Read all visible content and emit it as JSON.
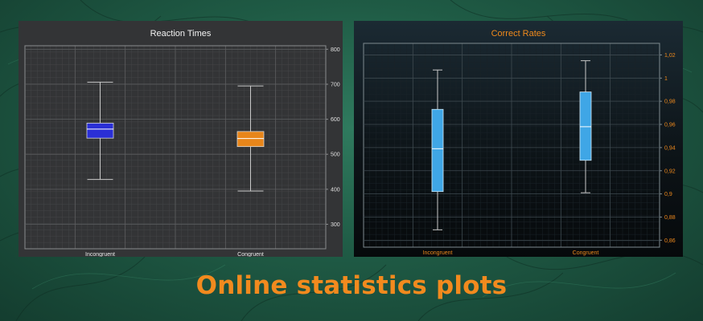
{
  "headline": "Online statistics plots",
  "colors": {
    "orange_accent": "#f28a1e",
    "left_panel_bg": "#333436",
    "right_panel_bg": "#0d1418",
    "blue_box": "#2a2fd6",
    "orange_box": "#e8861a",
    "light_blue_box": "#3fa6e6"
  },
  "chart_data": [
    {
      "type": "box",
      "title": "Reaction Times",
      "xlabel": "",
      "ylabel": "",
      "ylim": [
        230,
        810
      ],
      "yticks": [
        300,
        400,
        500,
        600,
        700,
        800
      ],
      "ytick_labels": [
        "300",
        "400",
        "500",
        "600",
        "700",
        "800"
      ],
      "grid": true,
      "categories": [
        "Incongruent",
        "Congruent"
      ],
      "boxes": [
        {
          "category": "Incongruent",
          "min": 428,
          "q1": 546,
          "median": 572,
          "q3": 589,
          "max": 706,
          "color": "#2a2fd6"
        },
        {
          "category": "Congruent",
          "min": 395,
          "q1": 522,
          "median": 545,
          "q3": 565,
          "max": 695,
          "color": "#e8861a"
        }
      ]
    },
    {
      "type": "box",
      "title": "Correct Rates",
      "xlabel": "",
      "ylabel": "",
      "ylim": [
        0.854,
        1.03
      ],
      "yticks": [
        0.86,
        0.88,
        0.9,
        0.92,
        0.94,
        0.96,
        0.98,
        1.0,
        1.02
      ],
      "ytick_labels": [
        "0,86",
        "0,88",
        "0,9",
        "0,92",
        "0,94",
        "0,96",
        "0,98",
        "1",
        "1,02"
      ],
      "grid": true,
      "categories": [
        "Incongruent",
        "Congruent"
      ],
      "boxes": [
        {
          "category": "Incongruent",
          "min": 0.869,
          "q1": 0.902,
          "median": 0.939,
          "q3": 0.973,
          "max": 1.007,
          "color": "#3fa6e6"
        },
        {
          "category": "Congruent",
          "min": 0.901,
          "q1": 0.929,
          "median": 0.958,
          "q3": 0.988,
          "max": 1.015,
          "color": "#3fa6e6"
        }
      ]
    }
  ]
}
